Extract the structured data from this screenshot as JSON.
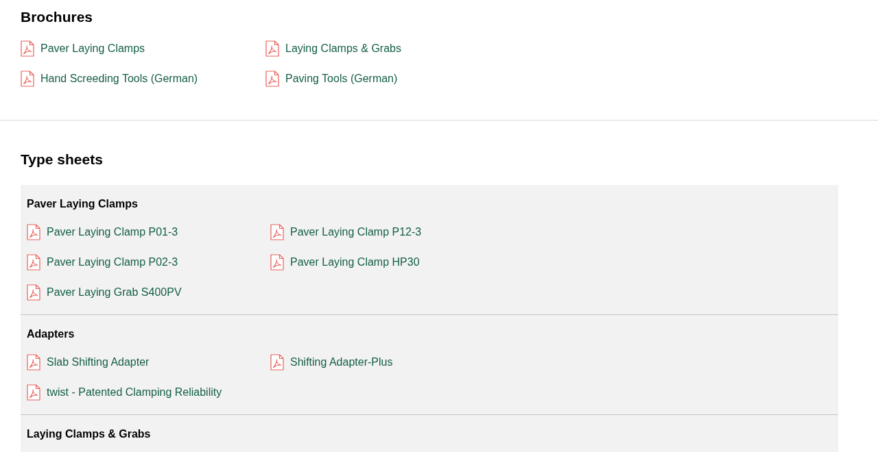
{
  "brochures": {
    "title": "Brochures",
    "items": [
      {
        "label": "Paver Laying Clamps"
      },
      {
        "label": "Laying Clamps & Grabs"
      },
      {
        "label": "Hand Screeding Tools (German)"
      },
      {
        "label": "Paving Tools (German)"
      }
    ]
  },
  "type_sheets": {
    "title": "Type sheets",
    "groups": [
      {
        "title": "Paver Laying Clamps",
        "items": [
          {
            "label": "Paver Laying Clamp P01-3"
          },
          {
            "label": "Paver Laying Clamp P12-3"
          },
          {
            "label": "Paver Laying Clamp P02-3"
          },
          {
            "label": "Paver Laying Clamp HP30"
          },
          {
            "label": "Paver Laying Grab S400PV"
          }
        ]
      },
      {
        "title": "Adapters",
        "items": [
          {
            "label": "Slab Shifting Adapter"
          },
          {
            "label": "Shifting Adapter-Plus"
          },
          {
            "label": "twist - Patented Clamping Reliability"
          }
        ]
      },
      {
        "title": "Laying Clamps & Grabs"
      }
    ]
  }
}
